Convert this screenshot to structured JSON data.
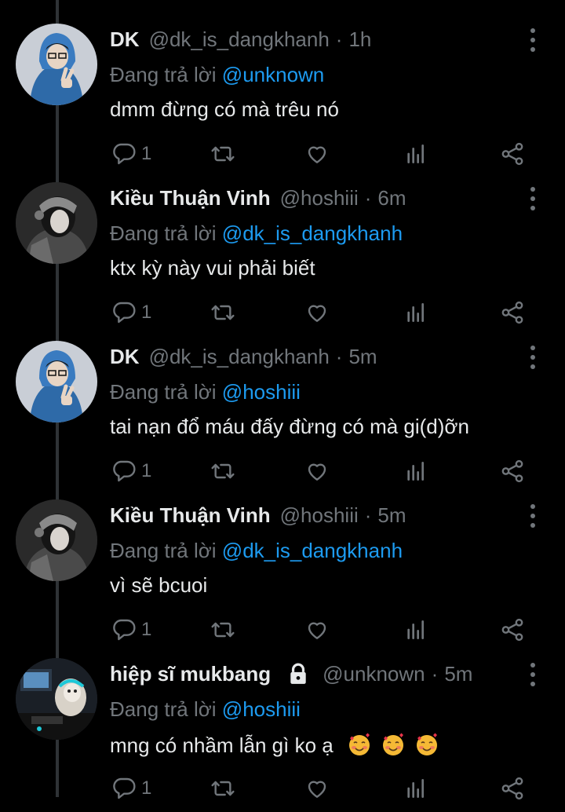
{
  "reply_prefix": "Đang trả lời",
  "tweets": [
    {
      "display_name": "DK",
      "handle": "@dk_is_dangkhanh",
      "time": "1h",
      "reply_to": "@unknown",
      "text": "dmm đừng có mà trêu nó",
      "reply_count": "1",
      "avatar": "avatar-blue-hoodie"
    },
    {
      "display_name": "Kiều Thuận Vinh",
      "handle": "@hoshiii",
      "time": "6m",
      "reply_to": "@dk_is_dangkhanh",
      "text": "ktx kỳ này vui phải biết",
      "reply_count": "1",
      "avatar": "avatar-dark-portrait"
    },
    {
      "display_name": "DK",
      "handle": "@dk_is_dangkhanh",
      "time": "5m",
      "reply_to": "@hoshiii",
      "text": "tai nạn đổ máu đấy đừng có mà gi(d)ỡn",
      "reply_count": "1",
      "avatar": "avatar-blue-hoodie"
    },
    {
      "display_name": "Kiều Thuận Vinh",
      "handle": "@hoshiii",
      "time": "5m",
      "reply_to": "@dk_is_dangkhanh",
      "text": "vì sẽ bcuoi",
      "reply_count": "1",
      "avatar": "avatar-dark-portrait"
    },
    {
      "display_name": "hiệp sĩ mukbang",
      "handle": "@unknown",
      "time": "5m",
      "reply_to": "@hoshiii",
      "text": "mng có nhầm lẫn gì ko ạ",
      "emoji": [
        "smiling-face-with-hearts",
        "smiling-face-with-hearts",
        "smiling-face-with-hearts"
      ],
      "reply_count": "1",
      "avatar": "avatar-gamer-monkey",
      "protected": true
    }
  ],
  "colors": {
    "background": "#000000",
    "text": "#e7e9ea",
    "muted": "#71767b",
    "accent": "#1d9bf0"
  }
}
